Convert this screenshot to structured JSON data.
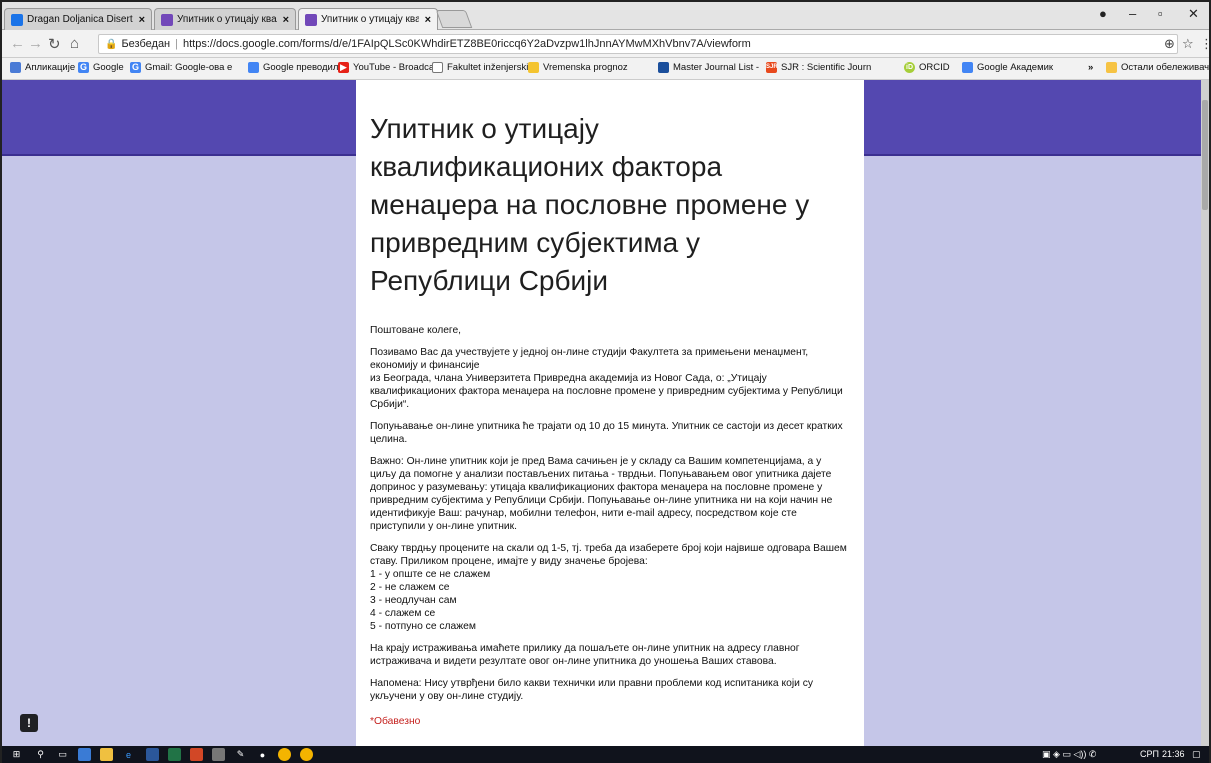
{
  "browser": {
    "tabs": [
      {
        "label": "Dragan Doljanica Disertac",
        "active": false,
        "icon_color": "#1a73e8"
      },
      {
        "label": "Упитник о утицају квали",
        "active": false,
        "icon_color": "#7248b9"
      },
      {
        "label": "Упитник о утицају квали",
        "active": true,
        "icon_color": "#7248b9"
      }
    ],
    "tab_close_glyph": "×",
    "security_label": "Безбедан",
    "url": "https://docs.google.com/forms/d/e/1FAIpQLSc0KWhdirETZ8BE0riccq6Y2aDvzpw1lhJnnAYMwMXhVbnv7A/viewform",
    "bookmarks": [
      {
        "label": "Апликације",
        "icon": "apps-icon"
      },
      {
        "label": "Google",
        "icon": "google-icon"
      },
      {
        "label": "Gmail: Google-ова е",
        "icon": "google-icon"
      },
      {
        "label": "Google преводилац",
        "icon": "translate-icon"
      },
      {
        "label": "YouTube - Broadcast",
        "icon": "youtube-icon"
      },
      {
        "label": "Fakultet inženjerskih",
        "icon": "page-icon"
      },
      {
        "label": "Vremenska prognoz",
        "icon": "weather-icon"
      },
      {
        "label": "Master Journal List -",
        "icon": "journal-icon"
      },
      {
        "label": "SJR : Scientific Journ",
        "icon": "sjr-icon"
      },
      {
        "label": "ORCID",
        "icon": "orcid-icon"
      },
      {
        "label": "Google Академик",
        "icon": "scholar-icon"
      }
    ],
    "bookmarks_overflow": "»",
    "other_bookmarks": "Остали обележивачи"
  },
  "form": {
    "title": "Упитник о утицају квалификационих фактора менаџера на пословне промене у привредним субјектима у Републици Србији",
    "paragraphs": [
      "Поштоване колеге,",
      "Позивамо Вас да учествујете у једној он-лине студији Факултета за примењени менаџмент, економију и финансије",
      " из Београда, члана Универзитета Привредна академија из Новог Сада, о: „Утицају квалификационих фактора менаџера на пословне промене у привредним субјектима у Републици Србији“.",
      "Попуњавање он-лине упитника ће трајати од 10 до 15 минута. Упитник се састоји из десет кратких целина.",
      "Важно: Он-лине упитник који је пред Вама сачињен је у складу са Вашим компетенцијама, а у циљу да помогне у анализи постављених питања - тврдњи. Попуњавањем овог упитника дајете допринос у разумевању: утицаја квалификационих фактора менаџера на пословне промене у привредним субјектима у Републици Србији. Попуњавање он-лине упитника ни на који начин не идентификује Ваш: рачунар, мобилни телефон, нити e-mail адресу, посредством које сте приступили у он-лине упитник.",
      "Сваку тврдњу процените на скали од 1-5, тј. треба да изаберете број који највише одговара Вашем ставу. Приликом процене, имајте у виду значење бројева:",
      "1 - у опште се не слажем",
      "2 - не слажем се",
      "3 - неодлучан сам",
      "4 - слажем се",
      "5 - потпуно се слажем",
      "На крају истраживања имаћете прилику да пошаљете он-лине упитник на адресу главног истраживача и видети резултате овог он-лине упитника до уношења Ваших ставова.",
      "Напомена: Нису утврђени било какви технички или правни проблеми код испитаника који су укључени у ову он-лине студију."
    ],
    "required_note": "*Обавезно"
  },
  "taskbar": {
    "language": "СРП",
    "time": "21:36"
  },
  "colors": {
    "header_band": "#5448b0",
    "page_background": "#c5c6e8",
    "required": "#c5221f"
  }
}
